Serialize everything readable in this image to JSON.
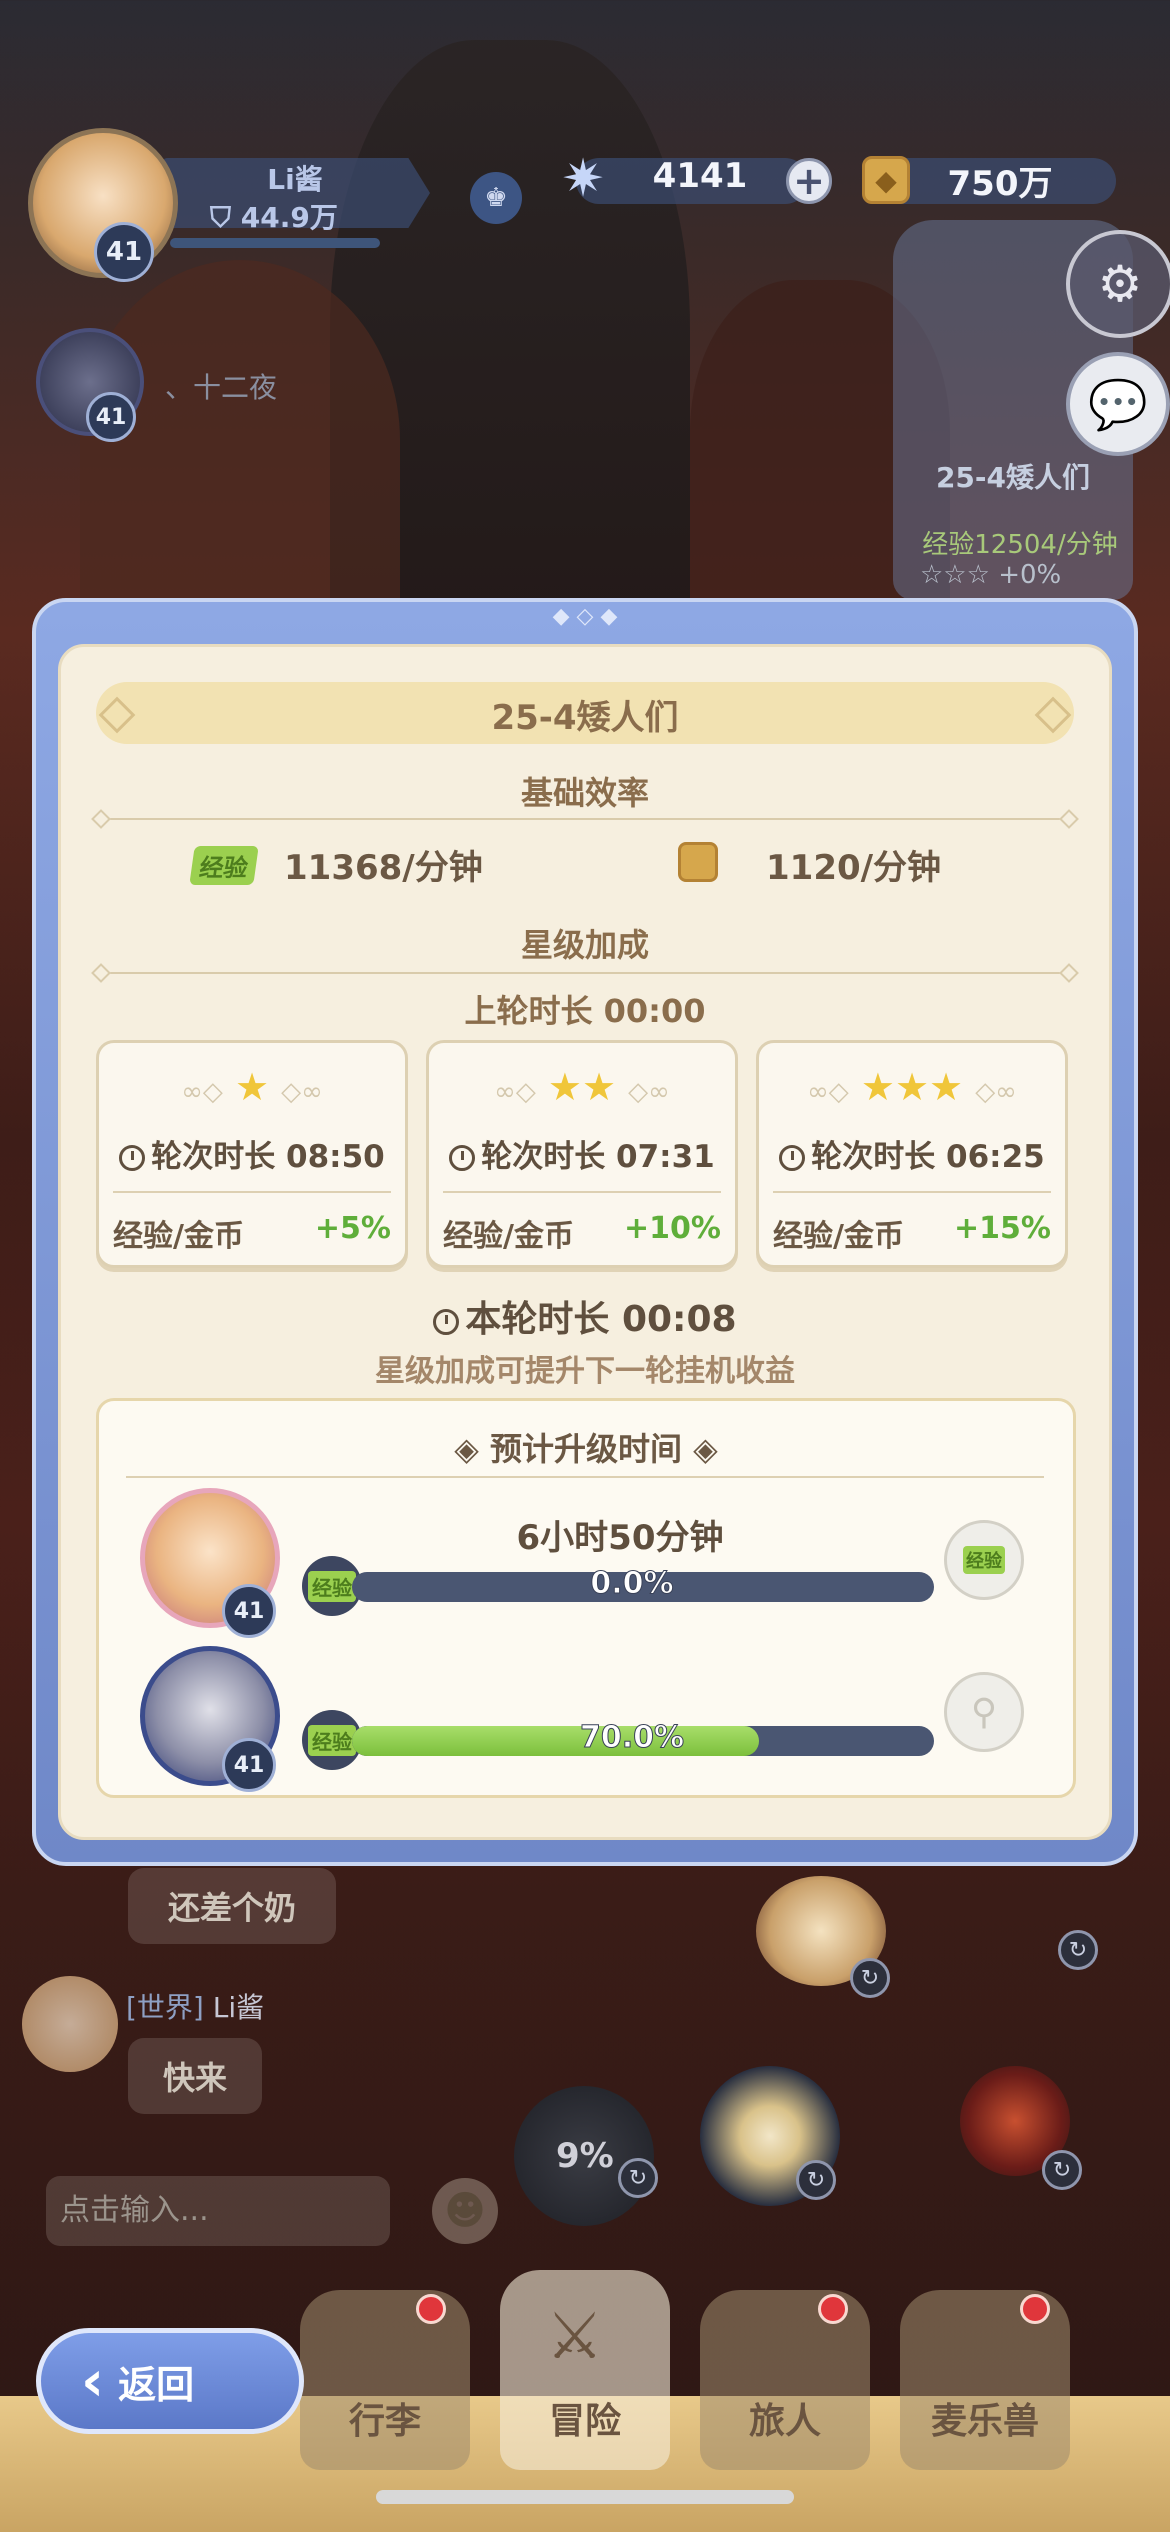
{
  "hud": {
    "player_name": "Li酱",
    "player_power": "44.9万",
    "player_level": "41",
    "friend_level": "41",
    "friend_name": "、十二夜",
    "gems": "4141",
    "coins": "750万",
    "plus_label": "+"
  },
  "side_stage": {
    "name": "25-4矮人们",
    "exp_label": "经验",
    "exp_rate": "12504",
    "exp_unit": "/分钟",
    "bonus": "+0%"
  },
  "panel": {
    "stage_title": "25-4矮人们",
    "base_title": "基础效率",
    "exp_tag": "经验",
    "exp_rate": "11368/分钟",
    "coin_rate": "1120/分钟",
    "star_title": "星级加成",
    "last_round": "上轮时长 00:00",
    "tiers": [
      {
        "stars": "★",
        "time_label": "轮次时长",
        "time": "08:50",
        "bonus_label": "经验/金币",
        "bonus": "+5%"
      },
      {
        "stars": "★★",
        "time_label": "轮次时长",
        "time": "07:31",
        "bonus_label": "经验/金币",
        "bonus": "+10%"
      },
      {
        "stars": "★★★",
        "time_label": "轮次时长",
        "time": "06:25",
        "bonus_label": "经验/金币",
        "bonus": "+15%"
      }
    ],
    "current_round": "本轮时长 00:08",
    "hint": "星级加成可提升下一轮挂机收益",
    "upgrade_title": "预计升级时间",
    "heroes": [
      {
        "level": "41",
        "time": "6小时50分钟",
        "exp_tag": "经验",
        "progress_label": "0.0%",
        "progress": 0.0
      },
      {
        "level": "41",
        "time": "",
        "exp_tag": "经验",
        "progress_label": "70.0%",
        "progress": 0.7
      }
    ],
    "potion_label": "经验"
  },
  "chat": {
    "msg1": "还差个奶",
    "channel": "[世界]",
    "sender": "Li酱",
    "msg2": "快来",
    "input_placeholder": "点击输入..."
  },
  "skills": [
    {
      "pct": "9%"
    }
  ],
  "nav": {
    "back": "返回",
    "tab_bag": "行李",
    "tab_adventure": "冒险",
    "tab_traveler": "旅人",
    "tab_beast": "麦乐兽"
  },
  "colors": {
    "accent_blue": "#7f9ee8",
    "exp_green": "#9bd04f",
    "bonus_green": "#5fae3a",
    "panel_bg": "#f6efdf",
    "title_brown": "#8a6d4c"
  }
}
